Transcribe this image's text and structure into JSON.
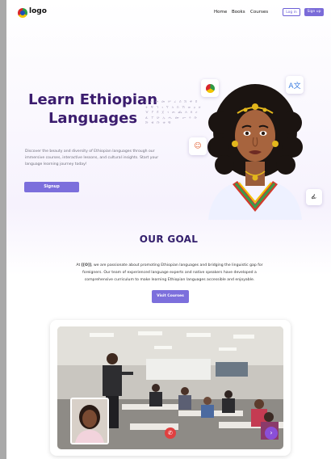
{
  "header": {
    "logo_text": "logo",
    "nav": [
      "Home",
      "Books",
      "Courses"
    ],
    "login_label": "Log in",
    "signup_label": "Sign up"
  },
  "hero": {
    "title_line1": "Learn Ethiopian",
    "title_line2": "Languages",
    "description": "Discover the beauty and diversity of Ethiopian languages through our immersive courses, interactive lessons, and cultural insights. Start your language learning journey today!",
    "button_label": "Signup",
    "glyphs": "ሀ ለ ሐ መ ሠ ረ ሰ ሸ ቀ በ ተ ቸ ኀ ነ ኘ አ ከ ኸ ወ ዐ ዘ ዠ የ ደ ጀ ገ ጠ ጨ ጰ ጸ ፀ ፈ ፐ ሁ ሉ ሑ ሙ ሡ ሩ ሱ ሹ ቁ ቡ ቱ ቹ"
  },
  "goal": {
    "title": "OUR GOAL",
    "text_prefix": "At ",
    "brand": "[[O]]",
    "text": ", we are passionate about promoting Ethiopian languages and bridging the linguistic gap for foreigners. Our team of experienced language experts and native speakers have developed a comprehensive curriculum to make learning Ethiopian languages accessible and enjoyable.",
    "button_label": "Visit Courses"
  },
  "video": {
    "hangup_icon": "phone-hangup-icon",
    "more_icon": "chevron-right-icon"
  },
  "colors": {
    "accent": "#7c6fdc",
    "title": "#3b1c6e"
  }
}
